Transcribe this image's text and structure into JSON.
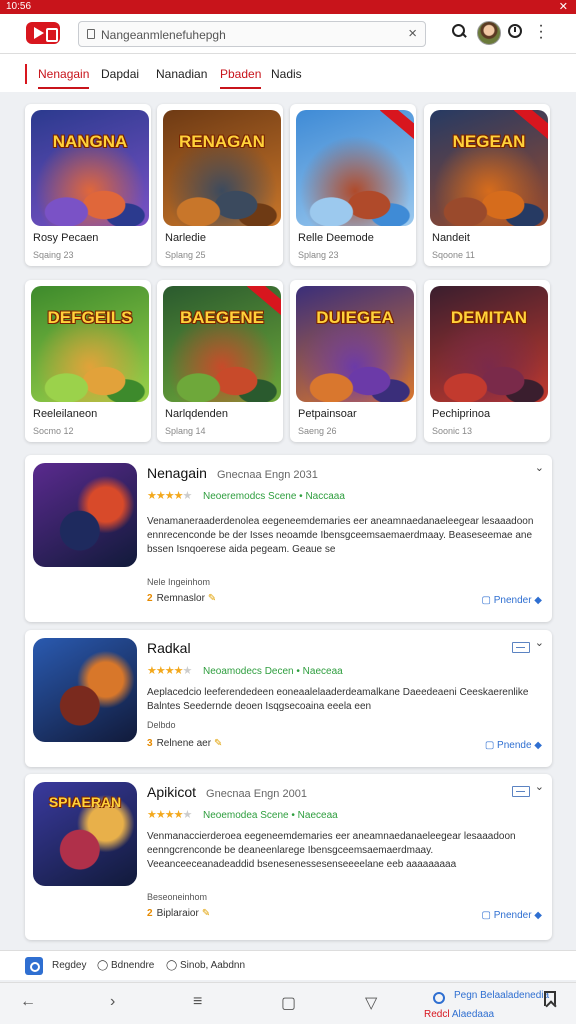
{
  "status_bar": {
    "time": "10:56",
    "close": "✕"
  },
  "search": {
    "value": "Nangeanmlenefuhepgh"
  },
  "tabs": [
    {
      "label": "Nenagain",
      "active": true
    },
    {
      "label": "Dapdai",
      "active": false
    },
    {
      "label": "Nanadian",
      "active": false
    },
    {
      "label": "Pbaden",
      "active": true
    },
    {
      "label": "Nadis",
      "active": false
    }
  ],
  "grid": [
    {
      "art_title": "NANGNA",
      "name": "Rosy Pecaen",
      "meta": "Sqaing  23",
      "c1": "#2b3a8e",
      "c2": "#7a52c6",
      "c3": "#e0673a",
      "ribbon": false
    },
    {
      "art_title": "RENAGAN",
      "name": "Narledie",
      "meta": "Splang  25",
      "c1": "#6e3a14",
      "c2": "#c8762a",
      "c3": "#3b4a5e",
      "ribbon": false
    },
    {
      "art_title": "",
      "name": "Relle Deemode",
      "meta": "Splang  23",
      "c1": "#3f8bd6",
      "c2": "#9cc9ee",
      "c3": "#b04a2a",
      "ribbon": true
    },
    {
      "art_title": "NEGEAN",
      "name": "Nandeit",
      "meta": "Sqoone  11",
      "c1": "#263a63",
      "c2": "#9a4a2c",
      "c3": "#d66c1c",
      "ribbon": true
    },
    {
      "art_title": "DEFGEILS",
      "name": "Reeleilaneon",
      "meta": "Socmo  12",
      "c1": "#3d8a2c",
      "c2": "#9bd24b",
      "c3": "#e2a23a",
      "ribbon": false
    },
    {
      "art_title": "BAEGENE",
      "name": "Narlqdenden",
      "meta": "Splang  14",
      "c1": "#2a5a2e",
      "c2": "#6ea83a",
      "c3": "#c84a2a",
      "ribbon": true
    },
    {
      "art_title": "DUIEGEA",
      "name": "Petpainsoar",
      "meta": "Saeng  26",
      "c1": "#3a2e7a",
      "c2": "#d9772e",
      "c3": "#6b3aa8",
      "ribbon": false
    },
    {
      "art_title": "DEMITAN",
      "name": "Pechiprinoa",
      "meta": "Soonic  13",
      "c1": "#3a1e2e",
      "c2": "#c23a2e",
      "c3": "#7a2a4a",
      "ribbon": false
    }
  ],
  "list": [
    {
      "title": "Nenagain",
      "subtitle": "Gnecnaa Engn 2031",
      "rating": 3.5,
      "green": "Neoeremodcs Scene • Naccaaa",
      "desc": "Venamaneraaderdenolea eegeneemdemaries eer aneamnaedanaeleegear lesaaadoon ennrecenconde be der Isses neoamde Ibensgceemsaemaerdmaay. Beaseseemae ane bssen Isnqoerese aida pegeam. Geaue se",
      "label": "Nele Ingeinhom",
      "rating_num": "2",
      "rating_text": "Remnaslor",
      "action": "Pnender",
      "art_title": "",
      "c1": "#5a2a8e",
      "c2": "#d84a2a",
      "c3": "#1e2a5e"
    },
    {
      "title": "Radkal",
      "subtitle": "",
      "rating": 3.5,
      "green": "Neoamodecs Decen • Naeceaa",
      "desc": "Aeplacedcio leeferendedeen eoneaalelaaderdeamalkane Daeedeaeni Ceeskaerenlike Balntes Seedernde deoen Isqgsecoaina eeela een",
      "label": "Delbdo",
      "rating_num": "3",
      "rating_text": "Relnene aer",
      "action": "Pnende",
      "art_title": "",
      "c1": "#2a5ab0",
      "c2": "#d8772a",
      "c3": "#7a2a1e"
    },
    {
      "title": "Apikicot",
      "subtitle": "Gnecnaa Engn 2001",
      "rating": 3.5,
      "green": "Neoemodea Scene • Naeceaa",
      "desc": "Venmanaccierderoea eegeneemdemaries eer aneamnaedanaeleegear lesaaadoon eenngcrenconde be deaneenlarege Ibensgceemsaemaerdmaay. Veeanceeceanadeaddid bsenesenessesenseeeelane eeb aaaaaaaaa",
      "label": "Beseoneinhom",
      "rating_num": "2",
      "rating_text": "Biplaraior",
      "action": "Pnender",
      "art_title": "SPIAERAN",
      "c1": "#3a3a9e",
      "c2": "#e8b04a",
      "c3": "#b0304a"
    }
  ],
  "chips": [
    {
      "label": "Regdey"
    },
    {
      "label": "Bdnendre"
    },
    {
      "label": "Sinob, Aabdnn"
    }
  ],
  "nav": {
    "promo": "Pegn Belaaladenedia",
    "promo2_red": "Redcl",
    "promo2_blue": "Alaedaaa"
  },
  "colors": {
    "accent": "#d8161e",
    "link": "#2f6fd1",
    "green": "#2e9e3e",
    "star": "#f3a81c"
  }
}
